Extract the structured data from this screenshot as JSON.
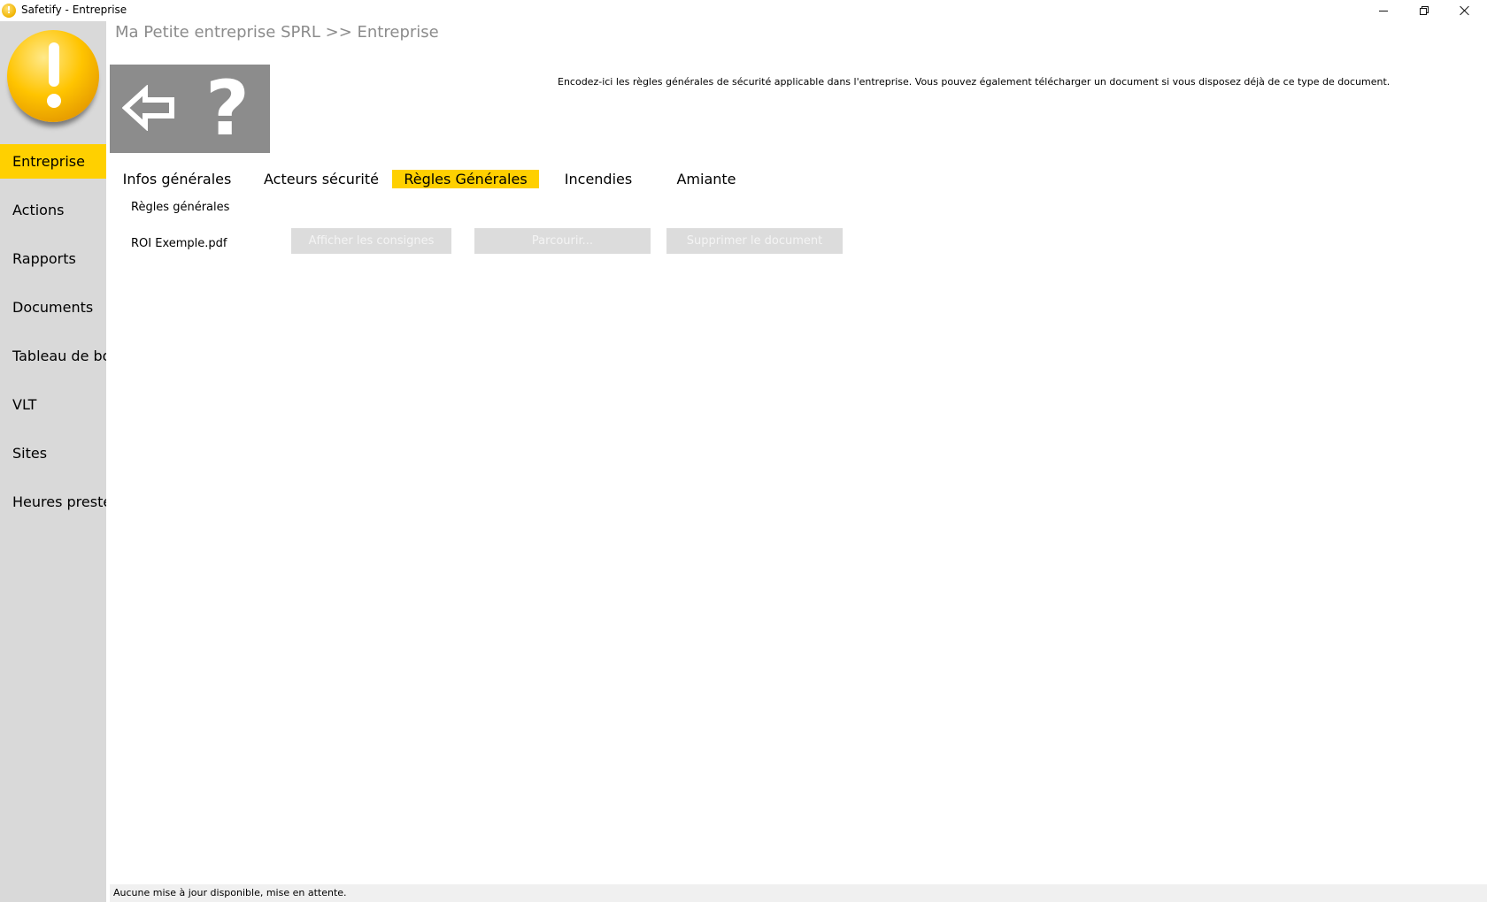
{
  "window": {
    "title": "Safetify - Entreprise",
    "app_icon_glyph": "!"
  },
  "sidebar": {
    "items": [
      {
        "label": "Entreprise",
        "active": true
      },
      {
        "label": "Actions",
        "active": false
      },
      {
        "label": "Rapports",
        "active": false
      },
      {
        "label": "Documents",
        "active": false
      },
      {
        "label": "Tableau de bor",
        "active": false
      },
      {
        "label": "VLT",
        "active": false
      },
      {
        "label": "Sites",
        "active": false
      },
      {
        "label": "Heures prestée",
        "active": false
      }
    ]
  },
  "header": {
    "breadcrumb": "Ma Petite entreprise SPRL >> Entreprise",
    "help_glyph": "?",
    "description": "Encodez-ici les règles générales de sécurité applicable dans l'entreprise.  Vous pouvez également télécharger un document si vous disposez déjà de ce type de document."
  },
  "tabs": [
    {
      "label": "Infos générales",
      "active": false
    },
    {
      "label": "Acteurs sécurité",
      "active": false
    },
    {
      "label": "Règles Générales",
      "active": true
    },
    {
      "label": "Incendies",
      "active": false
    },
    {
      "label": "Amiante",
      "active": false
    }
  ],
  "content": {
    "section_title": "Règles générales",
    "file_name": "ROI Exemple.pdf",
    "buttons": {
      "show": "Afficher les consignes",
      "browse": "Parcourir...",
      "delete": "Supprimer le document"
    }
  },
  "status": {
    "text": "Aucune mise à jour disponible, mise en attente."
  },
  "colors": {
    "accent": "#ffd000",
    "sidebar_bg": "#d9d9d9",
    "toolbar_bg": "#8c8c8c"
  }
}
